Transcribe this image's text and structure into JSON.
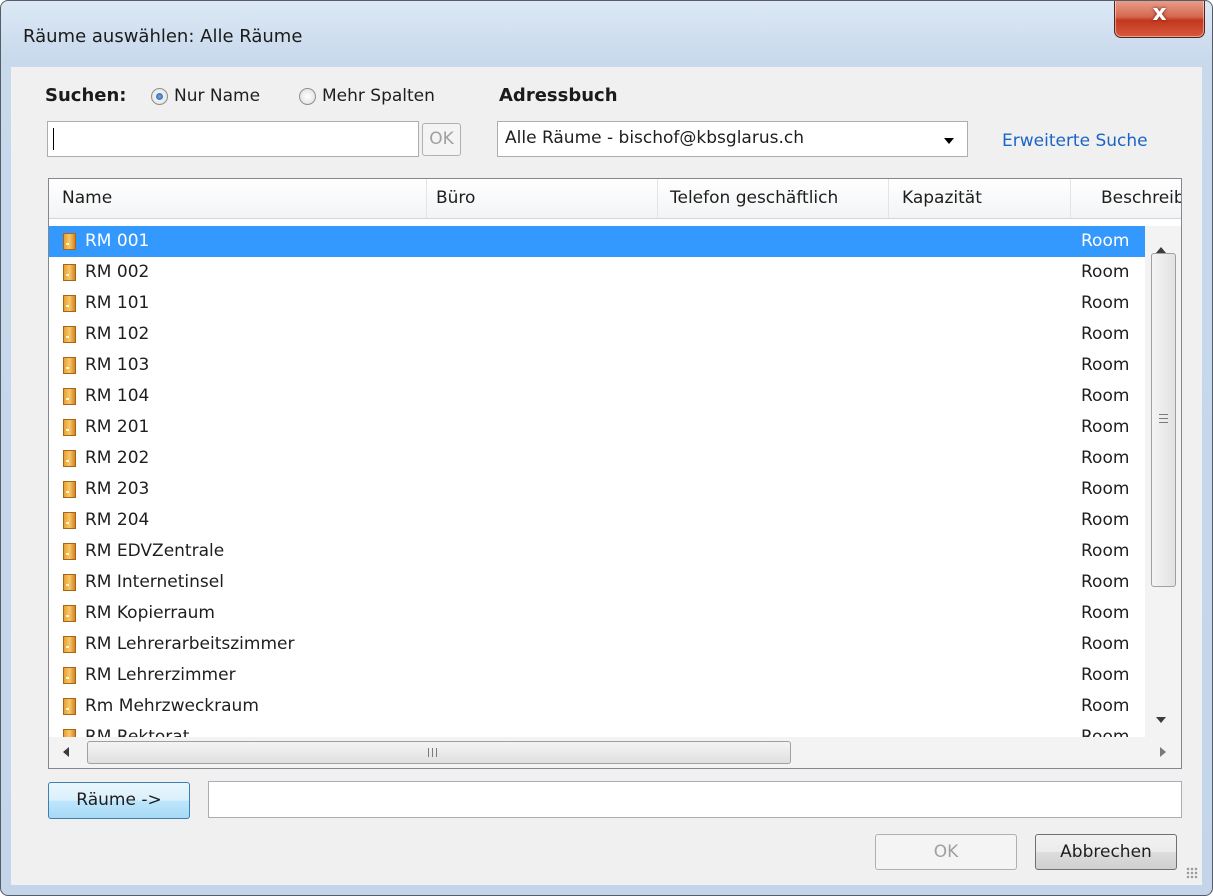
{
  "window": {
    "title": "Räume auswählen: Alle Räume",
    "close_glyph": "x"
  },
  "search": {
    "label": "Suchen:",
    "radio_name_only": "Nur Name",
    "radio_more_columns": "Mehr Spalten",
    "selected": "Nur Name",
    "input_value": "",
    "ok_label": "OK"
  },
  "addressbook": {
    "label": "Adressbuch",
    "selected": "Alle Räume - bischof@kbsglarus.ch",
    "advanced_link": "Erweiterte Suche"
  },
  "table": {
    "columns": [
      "Name",
      "Büro",
      "Telefon geschäftlich",
      "Kapazität",
      "Beschreib"
    ],
    "rows": [
      {
        "name": "RM 001",
        "desc": "Room",
        "selected": true
      },
      {
        "name": "RM 002",
        "desc": "Room"
      },
      {
        "name": "RM 101",
        "desc": "Room"
      },
      {
        "name": "RM 102",
        "desc": "Room"
      },
      {
        "name": "RM 103",
        "desc": "Room"
      },
      {
        "name": "RM 104",
        "desc": "Room"
      },
      {
        "name": "RM 201",
        "desc": "Room"
      },
      {
        "name": "RM 202",
        "desc": "Room"
      },
      {
        "name": "RM 203",
        "desc": "Room"
      },
      {
        "name": "RM 204",
        "desc": "Room"
      },
      {
        "name": "RM EDVZentrale",
        "desc": "Room"
      },
      {
        "name": "RM Internetinsel",
        "desc": "Room"
      },
      {
        "name": "RM Kopierraum",
        "desc": "Room"
      },
      {
        "name": "RM Lehrerarbeitszimmer",
        "desc": "Room"
      },
      {
        "name": "RM Lehrerzimmer",
        "desc": "Room"
      },
      {
        "name": "Rm Mehrzweckraum",
        "desc": "Room"
      },
      {
        "name": "RM Rektorat",
        "desc": "Room"
      }
    ]
  },
  "footer": {
    "rooms_button": "Räume ->",
    "rooms_value": "",
    "ok_label": "OK",
    "cancel_label": "Abbrechen"
  },
  "icons": {
    "row_icon": "room-icon",
    "close": "close-icon",
    "dropdown": "chevron-down-icon",
    "resize": "resize-grip-icon"
  },
  "colors": {
    "selection": "#3399ff",
    "link": "#1a64c8"
  }
}
